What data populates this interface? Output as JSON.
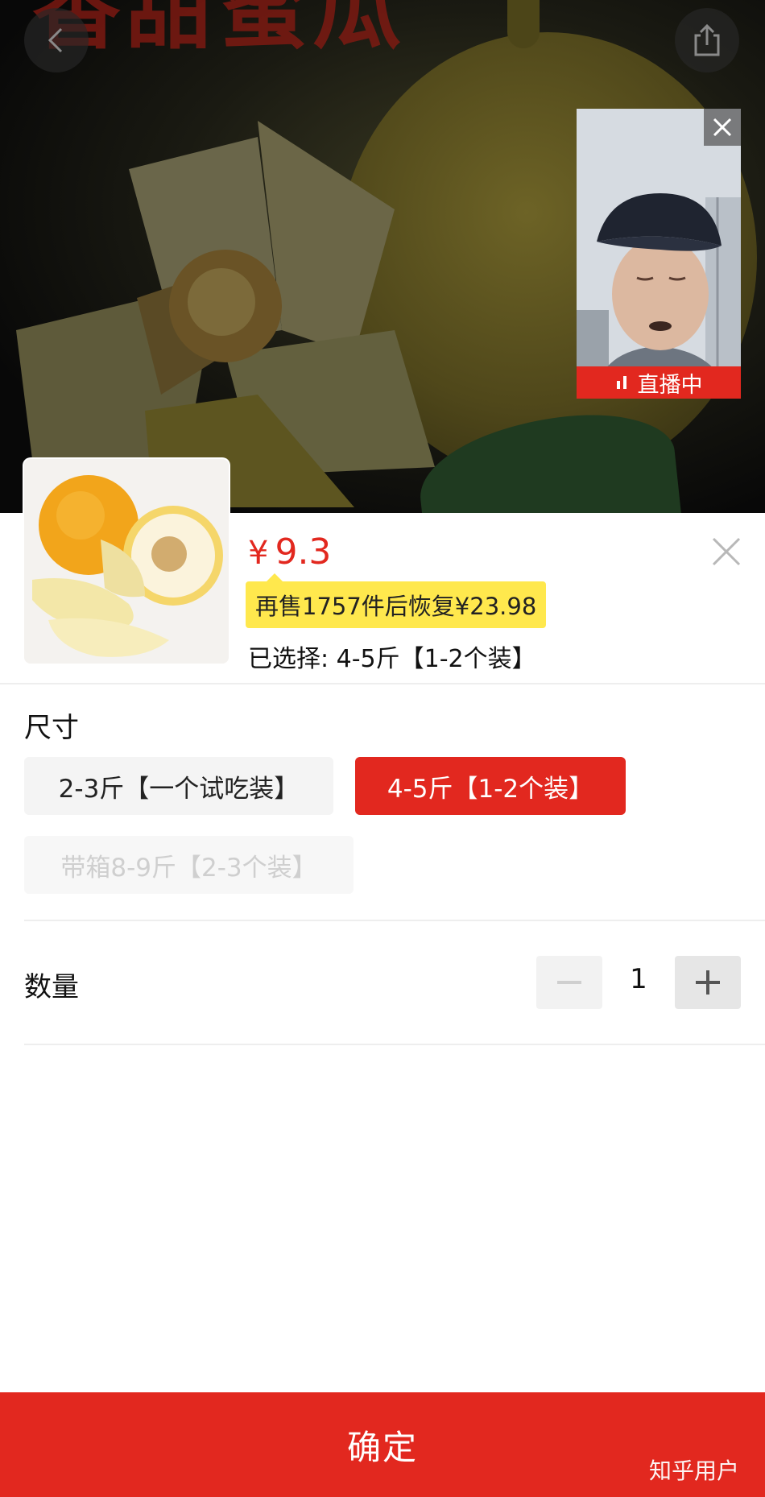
{
  "banner": {
    "title_text": "香甜蜜瓜"
  },
  "live": {
    "badge_label": "直播中",
    "close_icon": "close-icon"
  },
  "product": {
    "price_symbol": "¥",
    "price_value": "9.3",
    "promo_text": "再售1757件后恢复¥23.98",
    "selected_label": "已选择: 4-5斤【1-2个装】"
  },
  "size": {
    "title": "尺寸",
    "options": [
      {
        "label": "2-3斤【一个试吃装】",
        "state": "normal"
      },
      {
        "label": "4-5斤【1-2个装】",
        "state": "selected"
      },
      {
        "label": "带箱8-9斤【2-3个装】",
        "state": "disabled"
      }
    ]
  },
  "quantity": {
    "title": "数量",
    "value": "1",
    "minus_glyph": "−",
    "plus_glyph": "+"
  },
  "confirm": {
    "label": "确定"
  },
  "watermark": "知乎用户",
  "colors": {
    "accent": "#e2281f",
    "promo_bg": "#ffe84d"
  }
}
